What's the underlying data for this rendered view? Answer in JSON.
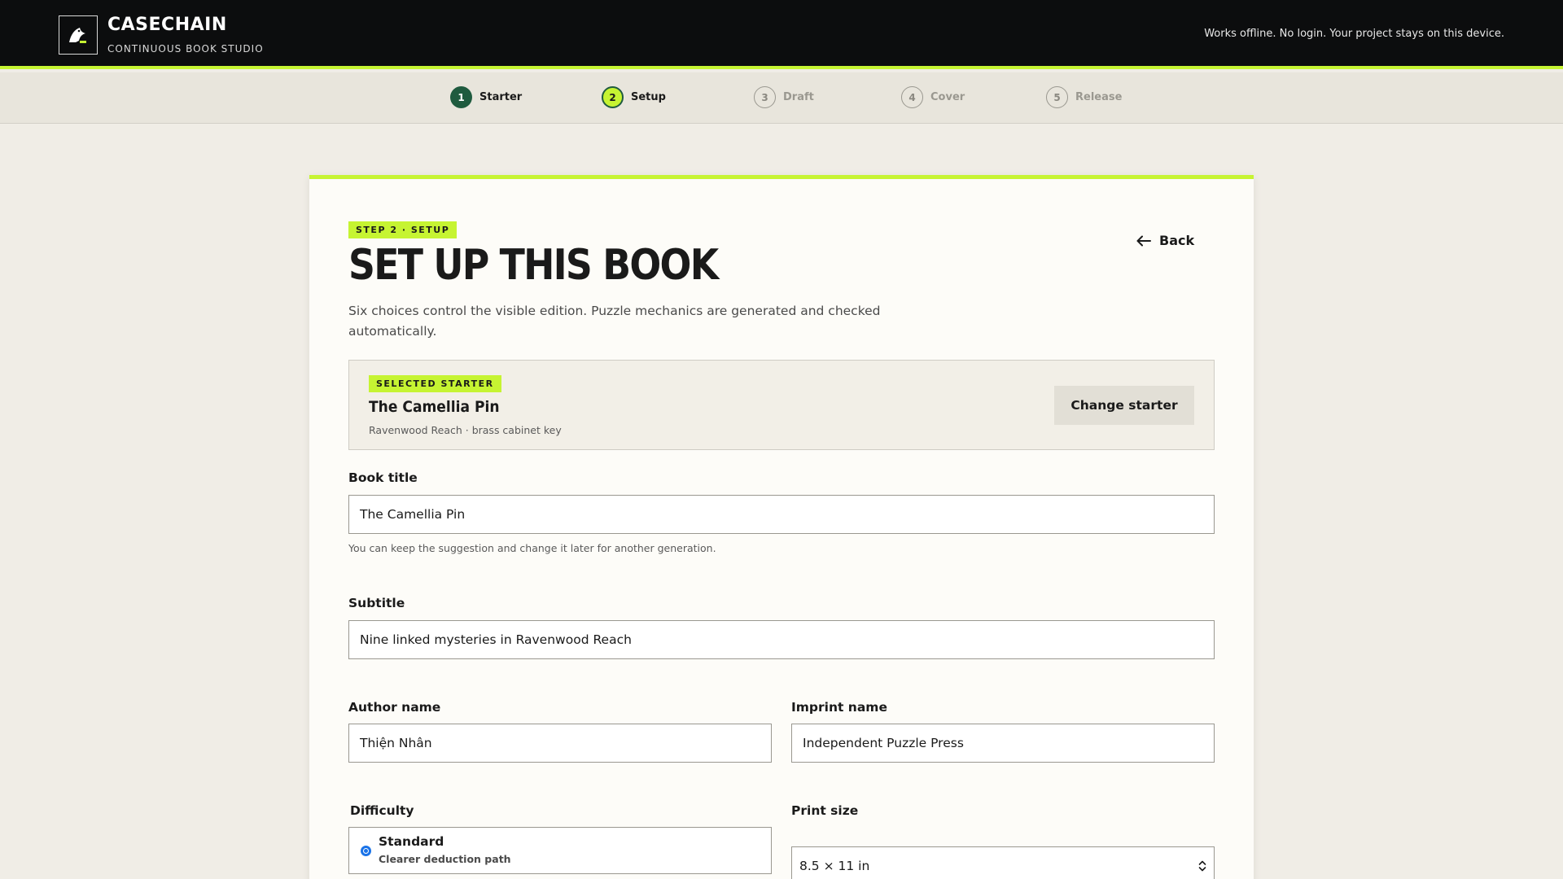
{
  "header": {
    "brand_name": "CASECHAIN",
    "brand_tag": "CONTINUOUS BOOK STUDIO",
    "offline_note": "Works offline. No login. Your project stays on this device."
  },
  "stepper": {
    "steps": [
      {
        "num": "1",
        "label": "Starter",
        "state": "done"
      },
      {
        "num": "2",
        "label": "Setup",
        "state": "active"
      },
      {
        "num": "3",
        "label": "Draft",
        "state": "todo"
      },
      {
        "num": "4",
        "label": "Cover",
        "state": "todo"
      },
      {
        "num": "5",
        "label": "Release",
        "state": "todo"
      }
    ]
  },
  "card": {
    "step_pill": "STEP 2 · SETUP",
    "title": "SET UP THIS BOOK",
    "intro": "Six choices control the visible edition. Puzzle mechanics are generated and checked automatically.",
    "back_label": "Back"
  },
  "starter": {
    "pill": "SELECTED STARTER",
    "title": "The Camellia Pin",
    "meta": "Ravenwood Reach · brass cabinet key",
    "change_label": "Change starter"
  },
  "form": {
    "book_title": {
      "label": "Book title",
      "value": "The Camellia Pin",
      "hint": "You can keep the suggestion and change it later for another generation."
    },
    "subtitle": {
      "label": "Subtitle",
      "value": "Nine linked mysteries in Ravenwood Reach"
    },
    "author": {
      "label": "Author name",
      "value": "Thiện Nhân"
    },
    "imprint": {
      "label": "Imprint name",
      "value": "Independent Puzzle Press"
    },
    "difficulty": {
      "label": "Difficulty",
      "options": [
        {
          "title": "Standard",
          "sub": "Clearer deduction path",
          "selected": true
        }
      ]
    },
    "print_size": {
      "label": "Print size",
      "value": "8.5 × 11 in"
    }
  },
  "colors": {
    "accent": "#c6f432",
    "header_bg": "#0c0d0e",
    "done_step": "#1f5b3f",
    "radio_blue": "#1a73e8"
  }
}
